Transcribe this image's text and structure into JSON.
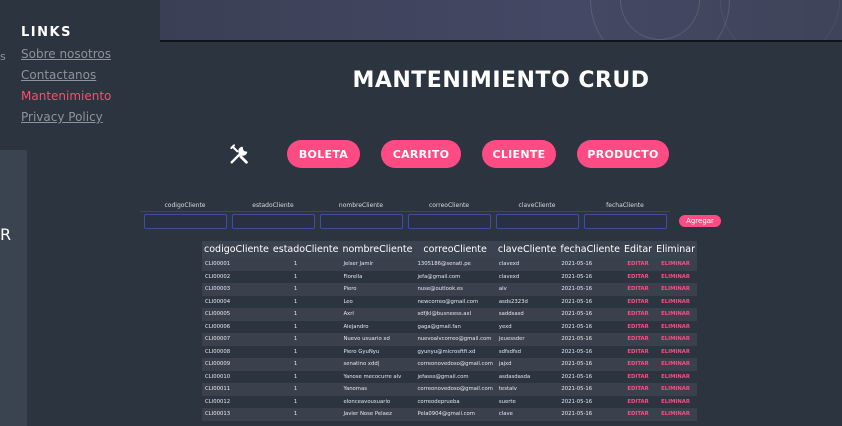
{
  "sidebar": {
    "title": "LINKS",
    "items": [
      {
        "label": "Sobre nosotros",
        "active": false
      },
      {
        "label": "Contactanos",
        "active": false
      },
      {
        "label": "Mantenimiento",
        "active": true
      },
      {
        "label": "Privacy Policy",
        "active": false
      }
    ],
    "edge_letter": "R"
  },
  "page": {
    "title": "MANTENIMIENTO CRUD"
  },
  "buttons": {
    "boleta": "BOLETA",
    "carrito": "CARRITO",
    "cliente": "CLIENTE",
    "producto": "PRODUCTO"
  },
  "form": {
    "labels": [
      "codigoCliente",
      "estadoCliente",
      "nombreCliente",
      "correoCliente",
      "claveCliente",
      "fechaCliente"
    ],
    "add_label": "Agregar"
  },
  "table": {
    "headers": [
      "codigoCliente",
      "estadoCliente",
      "nombreCliente",
      "correoCliente",
      "claveCliente",
      "fechaCliente",
      "Editar",
      "Eliminar"
    ],
    "edit_label": "EDITAR",
    "delete_label": "ELIMINAR",
    "rows": [
      [
        "CLI00001",
        "1",
        "Jeiser Jamir",
        "1305186@senati.pe",
        "clavexd",
        "2021-05-16"
      ],
      [
        "CLI00002",
        "1",
        "Fiorella",
        "jefa@gmail.com",
        "clavexd",
        "2021-05-16"
      ],
      [
        "CLI00003",
        "1",
        "Piero",
        "nuse@outlook.es",
        "alv",
        "2021-05-16"
      ],
      [
        "CLI00004",
        "1",
        "Leo",
        "newcorreo@gmail.com",
        "asds2323d",
        "2021-05-16"
      ],
      [
        "CLI00005",
        "1",
        "Axrl",
        "sdfjkl@busneess.axl",
        "saddsasd",
        "2021-05-16"
      ],
      [
        "CLI00006",
        "1",
        "Alejandro",
        "gaga@gmail.fan",
        "yexd",
        "2021-05-16"
      ],
      [
        "CLI00007",
        "1",
        "Nuevo usuario xd",
        "nuevoalvcorreo@gmail.com",
        "jeuessder",
        "2021-05-16"
      ],
      [
        "CLI00008",
        "1",
        "Piero GyuNyu",
        "gyunyu@microsftfi.xd",
        "sdfsdfsd",
        "2021-05-16"
      ],
      [
        "CLI00009",
        "1",
        "senatino xdd|",
        "correonovedoso@gmail.com",
        "jajxd",
        "2021-05-16"
      ],
      [
        "CLI00010",
        "1",
        "Yanose mecocurre alv",
        "jefasss@gmail.com",
        "asdasdasda",
        "2021-05-16"
      ],
      [
        "CLI00011",
        "1",
        "Yanomas",
        "correonovedoso@gmail.com",
        "testalv",
        "2021-05-16"
      ],
      [
        "CLI00012",
        "1",
        "elonceavousuario",
        "correodeprueba",
        "suerte",
        "2021-05-16"
      ],
      [
        "CLI00013",
        "1",
        "Javier Nose Pelaez",
        "Pela0904@gmail.com",
        "clave",
        "2021-05-16"
      ]
    ]
  },
  "colors": {
    "accent": "#ff4b84",
    "active_link": "#ff4b6e",
    "background": "#2c343f"
  }
}
